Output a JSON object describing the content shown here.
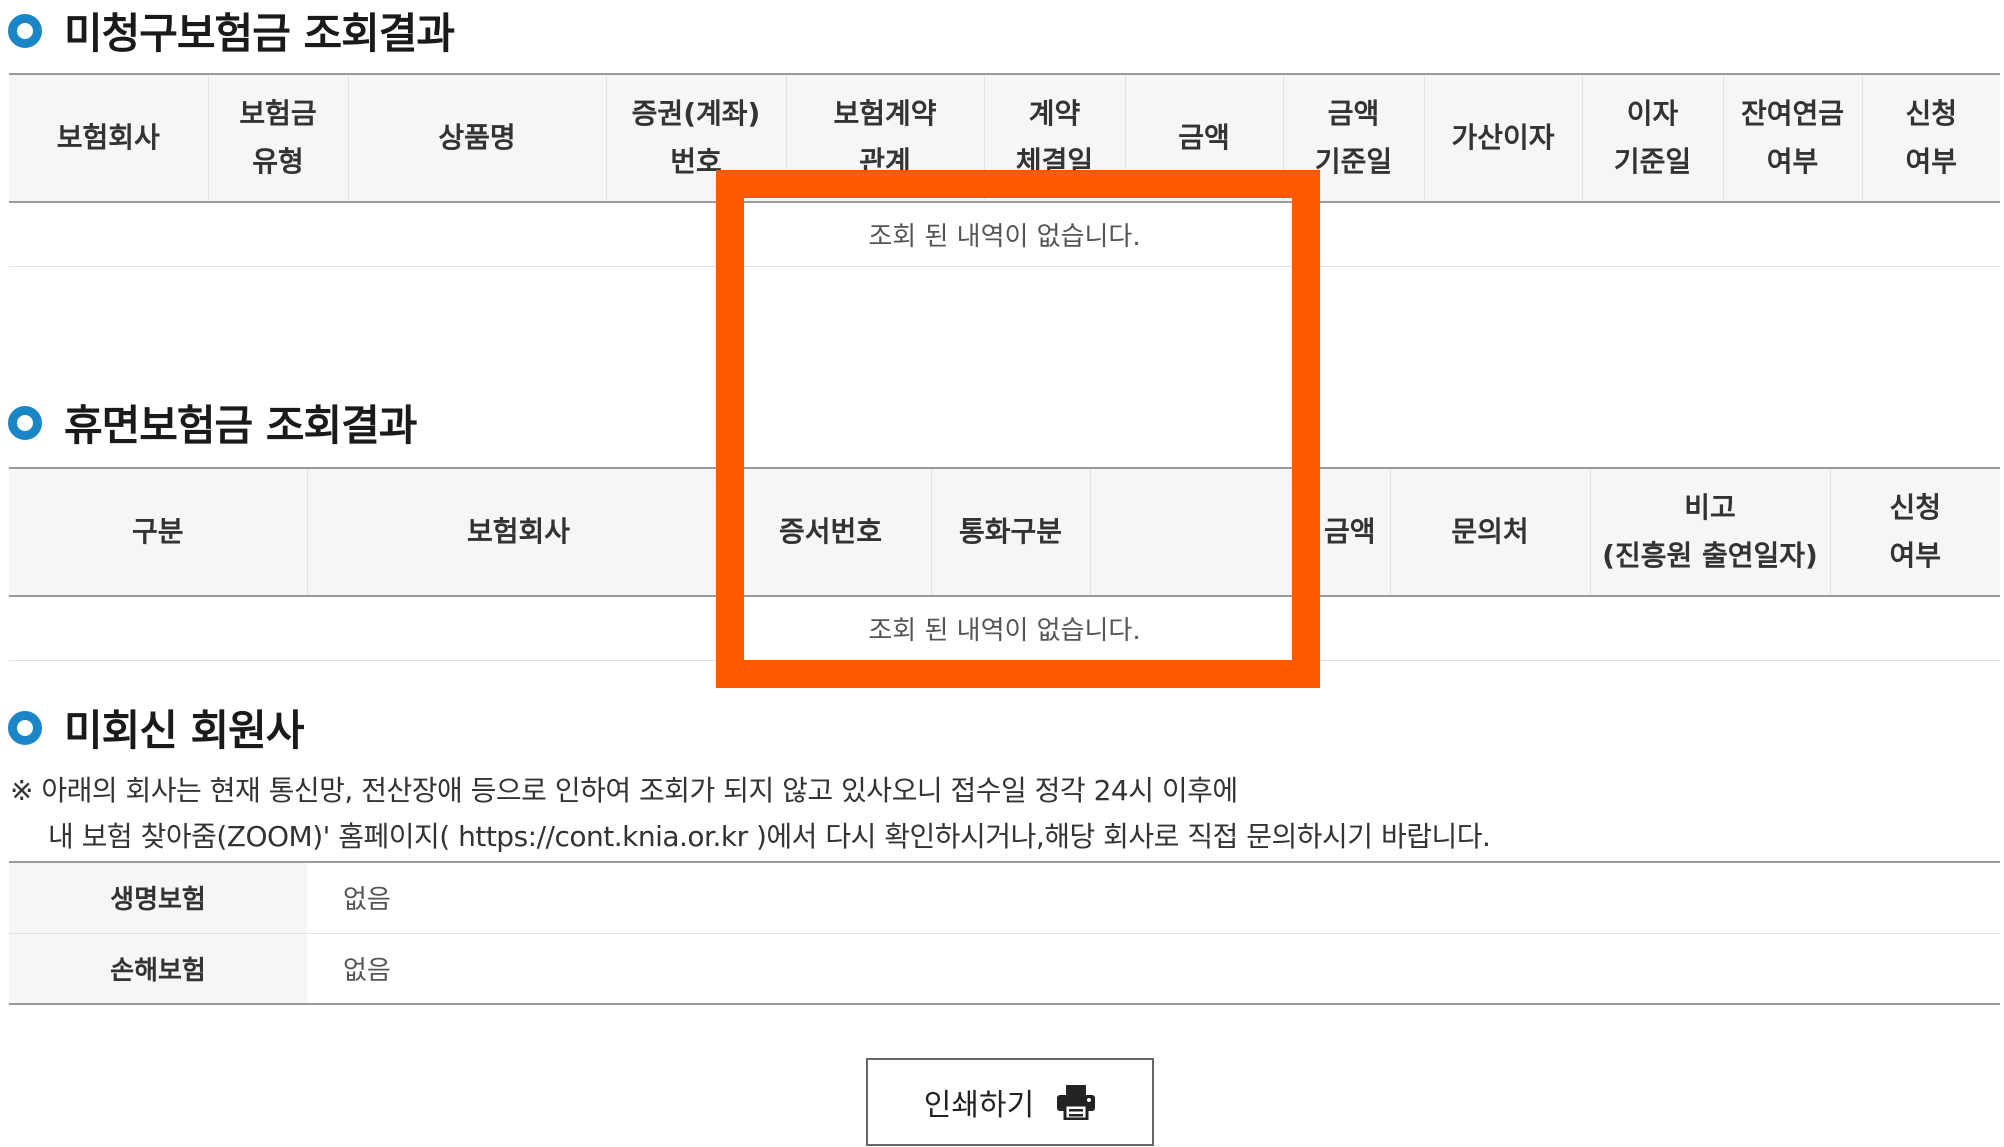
{
  "unclaimed": {
    "title": "미청구보험금 조회결과",
    "columns": [
      {
        "l1": "보험회사",
        "l2": ""
      },
      {
        "l1": "보험금",
        "l2": "유형"
      },
      {
        "l1": "상품명",
        "l2": ""
      },
      {
        "l1": "증권(계좌)",
        "l2": "번호"
      },
      {
        "l1": "보험계약",
        "l2": "관계"
      },
      {
        "l1": "계약",
        "l2": "체결일"
      },
      {
        "l1": "금액",
        "l2": ""
      },
      {
        "l1": "금액",
        "l2": "기준일"
      },
      {
        "l1": "가산이자",
        "l2": ""
      },
      {
        "l1": "이자",
        "l2": "기준일"
      },
      {
        "l1": "잔여연금",
        "l2": "여부"
      },
      {
        "l1": "신청",
        "l2": "여부"
      }
    ],
    "empty_message": "조회 된 내역이 없습니다."
  },
  "dormant": {
    "title": "휴면보험금 조회결과",
    "columns": [
      {
        "l1": "구분",
        "l2": ""
      },
      {
        "l1": "보험회사",
        "l2": ""
      },
      {
        "l1": "증서번호",
        "l2": ""
      },
      {
        "l1": "통화구분",
        "l2": ""
      },
      {
        "l1": "금액",
        "l2": ""
      },
      {
        "l1": "문의처",
        "l2": ""
      },
      {
        "l1": "비고",
        "l2": "(진흥원 출연일자)"
      },
      {
        "l1": "신청",
        "l2": "여부"
      }
    ],
    "empty_message": "조회 된 내역이 없습니다."
  },
  "nonresponding": {
    "title": "미회신 회원사",
    "notice_line1": "※ 아래의 회사는 현재 통신망, 전산장애 등으로 인하여 조회가 되지 않고 있사오니 접수일 정각 24시 이후에",
    "notice_line2": "내 보험 찾아줌(ZOOM)' 홈페이지( https://cont.knia.or.kr )에서 다시 확인하시거나,해당 회사로 직접 문의하시기 바랍니다.",
    "rows": [
      {
        "label": "생명보험",
        "value": "없음"
      },
      {
        "label": "손해보험",
        "value": "없음"
      }
    ]
  },
  "print_button": {
    "label": "인쇄하기",
    "icon": "printer-icon"
  },
  "colors": {
    "accent": "#1a86c8",
    "highlight": "#ff5a00",
    "header_bg": "#f6f6f6"
  }
}
